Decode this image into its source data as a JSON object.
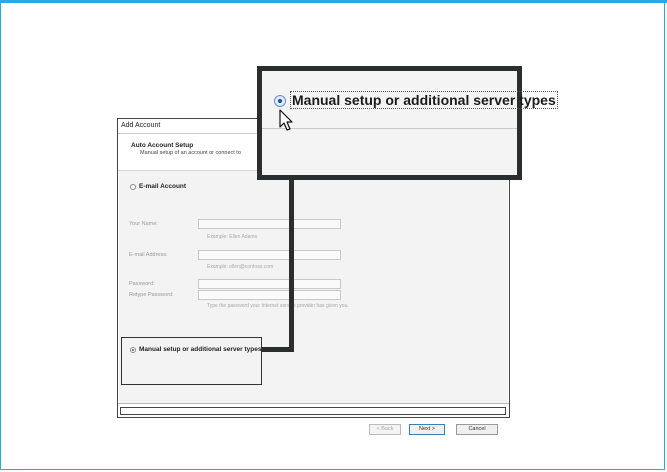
{
  "dialog": {
    "title": "Add Account",
    "header_title": "Auto Account Setup",
    "header_subtitle": "Manual setup of an account or connect to",
    "email_account_label": "E-mail Account",
    "fields": [
      {
        "label": "Your Name:",
        "hint": "Example: Ellen Adams"
      },
      {
        "label": "E-mail Address:",
        "hint": "Example: ellen@contoso.com"
      },
      {
        "label": "Password:",
        "hint": ""
      },
      {
        "label": "Retype Password:",
        "hint": "Type the password your Internet service provider has given you."
      }
    ],
    "manual_setup_label": "Manual setup or additional server types",
    "buttons": {
      "back": "< Back",
      "next": "Next >",
      "cancel": "Cancel"
    }
  },
  "zoom": {
    "manual_setup_label": "Manual setup or additional server types"
  },
  "colors": {
    "frame": "#29abe2",
    "callout": "#2b2e2e",
    "radio_dot": "#1e4f9c"
  }
}
